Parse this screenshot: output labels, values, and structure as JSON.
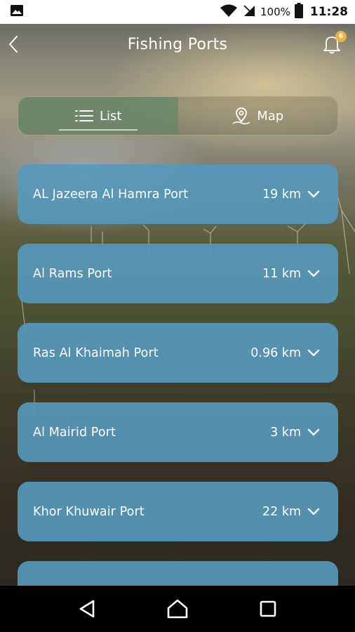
{
  "status_bar": {
    "battery_percent": "100%",
    "time": "11:28",
    "icons": [
      "image-icon",
      "wifi-icon",
      "no-sim-icon",
      "battery-icon"
    ]
  },
  "header": {
    "title": "Fishing Ports",
    "back_icon": "chevron-left-icon",
    "bell_icon": "bell-icon",
    "notification_count": "6"
  },
  "view_toggle": {
    "tabs": [
      {
        "label": "List",
        "icon": "list-icon",
        "active": true
      },
      {
        "label": "Map",
        "icon": "map-pin-icon",
        "active": false
      }
    ]
  },
  "ports": [
    {
      "name": "AL Jazeera Al Hamra Port",
      "distance": "19 km"
    },
    {
      "name": "Al Rams Port",
      "distance": "11 km"
    },
    {
      "name": "Ras Al Khaimah Port",
      "distance": "0.96 km"
    },
    {
      "name": "Al Mairid Port",
      "distance": "3 km"
    },
    {
      "name": "Khor Khuwair Port",
      "distance": "22 km"
    }
  ],
  "nav_bar": {
    "buttons": [
      "back-triangle-icon",
      "home-icon",
      "recents-square-icon"
    ]
  },
  "colors": {
    "card": "#5698bc",
    "active_tab": "#69876a",
    "badge": "#e7b445",
    "status_bar_bg": "#ffffff",
    "nav_bar_bg": "#000000"
  }
}
